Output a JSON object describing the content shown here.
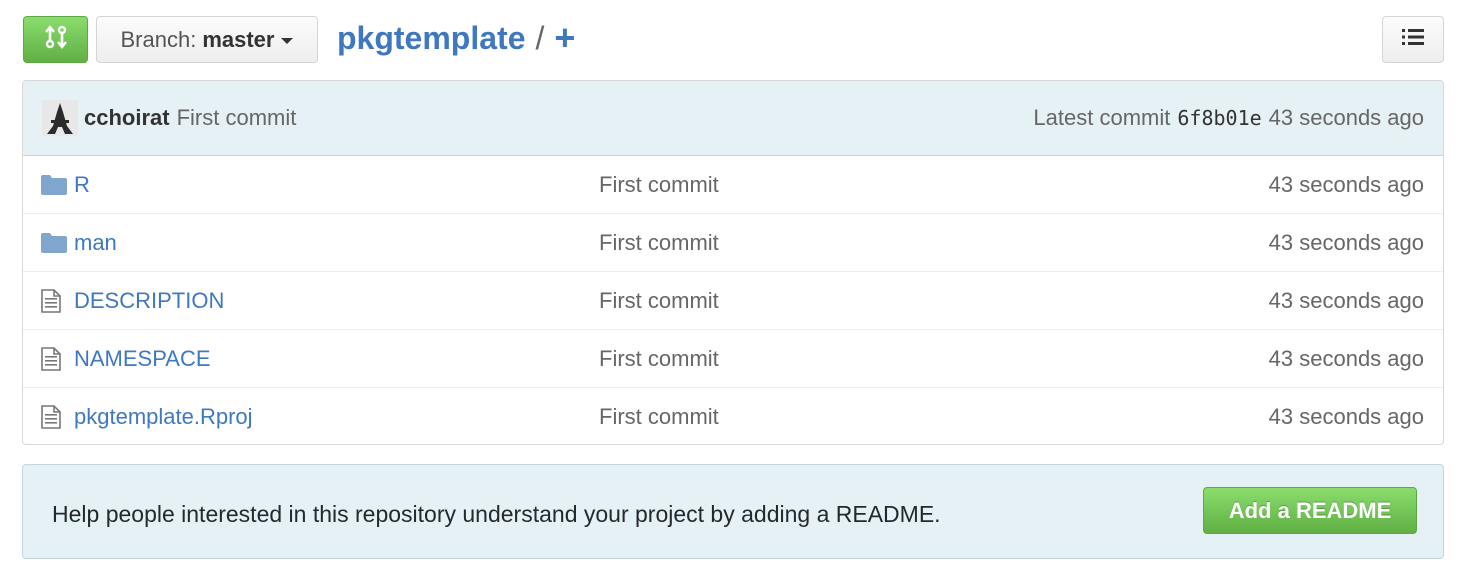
{
  "toolbar": {
    "branch_label": "Branch:",
    "branch_name": "master",
    "repo_name": "pkgtemplate",
    "separator": "/",
    "add_file": "+"
  },
  "commit": {
    "author": "cchoirat",
    "message": "First commit",
    "latest_label": "Latest commit",
    "sha": "6f8b01e",
    "age": "43 seconds ago"
  },
  "files": [
    {
      "name": "R",
      "type": "folder",
      "message": "First commit",
      "age": "43 seconds ago"
    },
    {
      "name": "man",
      "type": "folder",
      "message": "First commit",
      "age": "43 seconds ago"
    },
    {
      "name": "DESCRIPTION",
      "type": "file",
      "message": "First commit",
      "age": "43 seconds ago"
    },
    {
      "name": "NAMESPACE",
      "type": "file",
      "message": "First commit",
      "age": "43 seconds ago"
    },
    {
      "name": "pkgtemplate.Rproj",
      "type": "file",
      "message": "First commit",
      "age": "43 seconds ago"
    }
  ],
  "readme": {
    "prompt": "Help people interested in this repository understand your project by adding a README.",
    "button_label": "Add a README"
  },
  "icons": {
    "compare": "git-compare-icon",
    "branch_caret": "caret-down-icon",
    "list": "list-icon",
    "folder": "folder-icon",
    "file": "file-text-icon"
  },
  "colors": {
    "link": "#4078c0",
    "green": "#6cc644",
    "commit_bar": "#e6f1f6"
  }
}
